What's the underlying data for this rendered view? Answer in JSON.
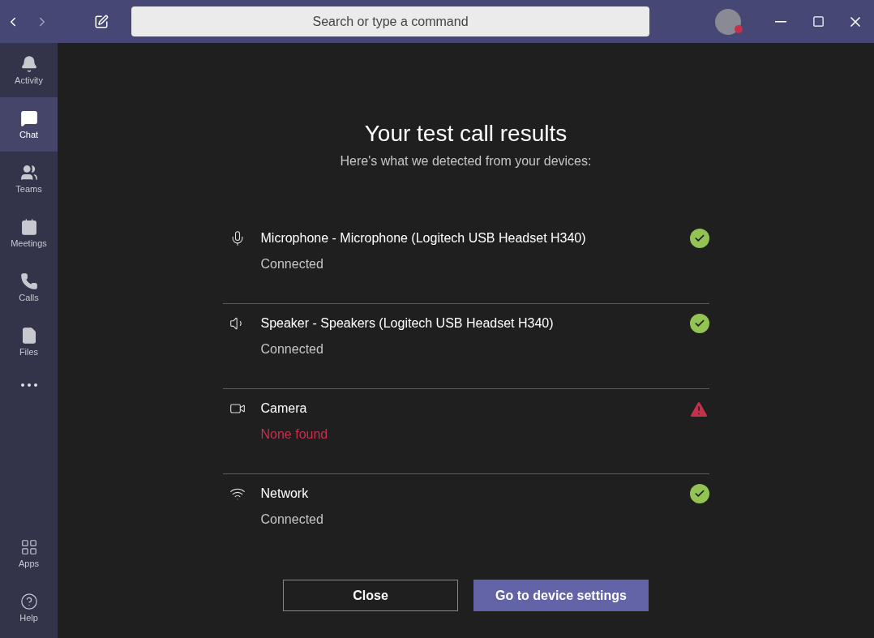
{
  "top_bar": {
    "search": {
      "placeholder": "Search or type a command"
    }
  },
  "sidebar": {
    "items": [
      {
        "kind": "activity",
        "label": "Activity",
        "selected": false
      },
      {
        "kind": "chat",
        "label": "Chat",
        "selected": true
      },
      {
        "kind": "teams",
        "label": "Teams",
        "selected": false
      },
      {
        "kind": "meetings",
        "label": "Meetings",
        "selected": false
      },
      {
        "kind": "calls",
        "label": "Calls",
        "selected": false
      },
      {
        "kind": "files",
        "label": "Files",
        "selected": false
      }
    ],
    "bottom_items": [
      {
        "kind": "apps",
        "label": "Apps"
      },
      {
        "kind": "help",
        "label": "Help"
      }
    ]
  },
  "dialog": {
    "title": "Your test call results",
    "subtitle": "Here's what we detected from your devices:",
    "devices": [
      {
        "kind": "microphone",
        "name": "Microphone - Microphone (Logitech USB Headset H340)",
        "status": "Connected",
        "ok": true
      },
      {
        "kind": "speaker",
        "name": "Speaker - Speakers (Logitech USB Headset H340)",
        "status": "Connected",
        "ok": true
      },
      {
        "kind": "camera",
        "name": "Camera",
        "status": "None found",
        "ok": false
      },
      {
        "kind": "network",
        "name": "Network",
        "status": "Connected",
        "ok": true
      }
    ],
    "buttons": [
      {
        "kind": "secondary",
        "label": "Close"
      },
      {
        "kind": "primary",
        "label": "Go to device settings"
      }
    ]
  }
}
